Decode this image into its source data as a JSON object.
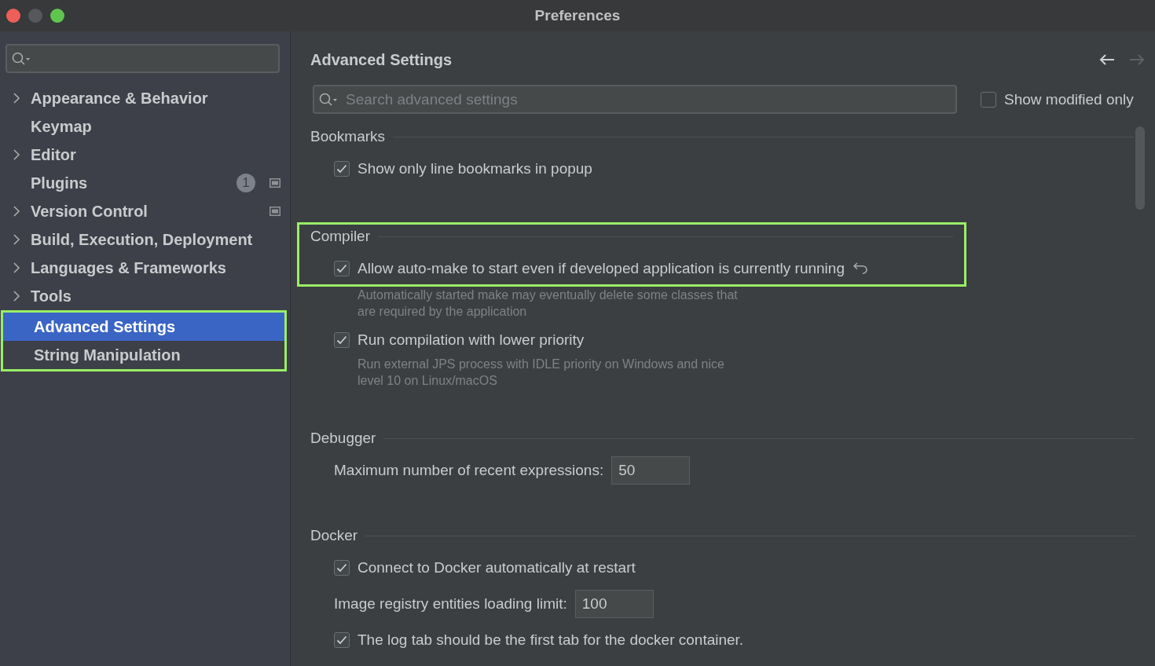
{
  "window": {
    "title": "Preferences"
  },
  "sidebar": {
    "items": [
      {
        "label": "Appearance & Behavior",
        "expandable": true,
        "selected": false,
        "highlighted": false
      },
      {
        "label": "Keymap",
        "expandable": false,
        "selected": false,
        "highlighted": false
      },
      {
        "label": "Editor",
        "expandable": true,
        "selected": false,
        "highlighted": false
      },
      {
        "label": "Plugins",
        "expandable": false,
        "badge": "1",
        "scope_icon": true,
        "selected": false,
        "highlighted": false
      },
      {
        "label": "Version Control",
        "expandable": true,
        "scope_icon": true,
        "selected": false,
        "highlighted": false
      },
      {
        "label": "Build, Execution, Deployment",
        "expandable": true,
        "selected": false,
        "highlighted": false
      },
      {
        "label": "Languages & Frameworks",
        "expandable": true,
        "selected": false,
        "highlighted": false
      },
      {
        "label": "Tools",
        "expandable": true,
        "selected": false,
        "highlighted": false
      },
      {
        "label": "Advanced Settings",
        "expandable": false,
        "selected": true,
        "highlighted": true
      },
      {
        "label": "String Manipulation",
        "expandable": false,
        "selected": false,
        "highlighted": true
      }
    ]
  },
  "main": {
    "title": "Advanced Settings",
    "nav": {
      "back_enabled": true,
      "forward_enabled": false
    },
    "search": {
      "placeholder": "Search advanced settings"
    },
    "show_modified_only": {
      "label": "Show modified only",
      "checked": false
    },
    "sections": [
      {
        "title": "Bookmarks",
        "highlighted": false,
        "items": [
          {
            "kind": "checkbox",
            "label": "Show only line bookmarks in popup",
            "checked": true
          }
        ]
      },
      {
        "title": "Compiler",
        "highlighted": true,
        "items": [
          {
            "kind": "checkbox",
            "label": "Allow auto-make to start even if developed application is currently running",
            "checked": true,
            "modified": true,
            "description": "Automatically started make may eventually delete some classes that are required by the application"
          },
          {
            "kind": "checkbox",
            "label": "Run compilation with lower priority",
            "checked": true,
            "description": "Run external JPS process with IDLE priority on Windows and nice level 10 on Linux/macOS"
          }
        ]
      },
      {
        "title": "Debugger",
        "highlighted": false,
        "items": [
          {
            "kind": "number",
            "label": "Maximum number of recent expressions:",
            "value": "50"
          }
        ]
      },
      {
        "title": "Docker",
        "highlighted": false,
        "items": [
          {
            "kind": "checkbox",
            "label": "Connect to Docker automatically at restart",
            "checked": true
          },
          {
            "kind": "number",
            "label": "Image registry entities loading limit:",
            "value": "100"
          },
          {
            "kind": "checkbox",
            "label": "The log tab should be the first tab for the docker container.",
            "checked": true
          }
        ]
      }
    ]
  }
}
